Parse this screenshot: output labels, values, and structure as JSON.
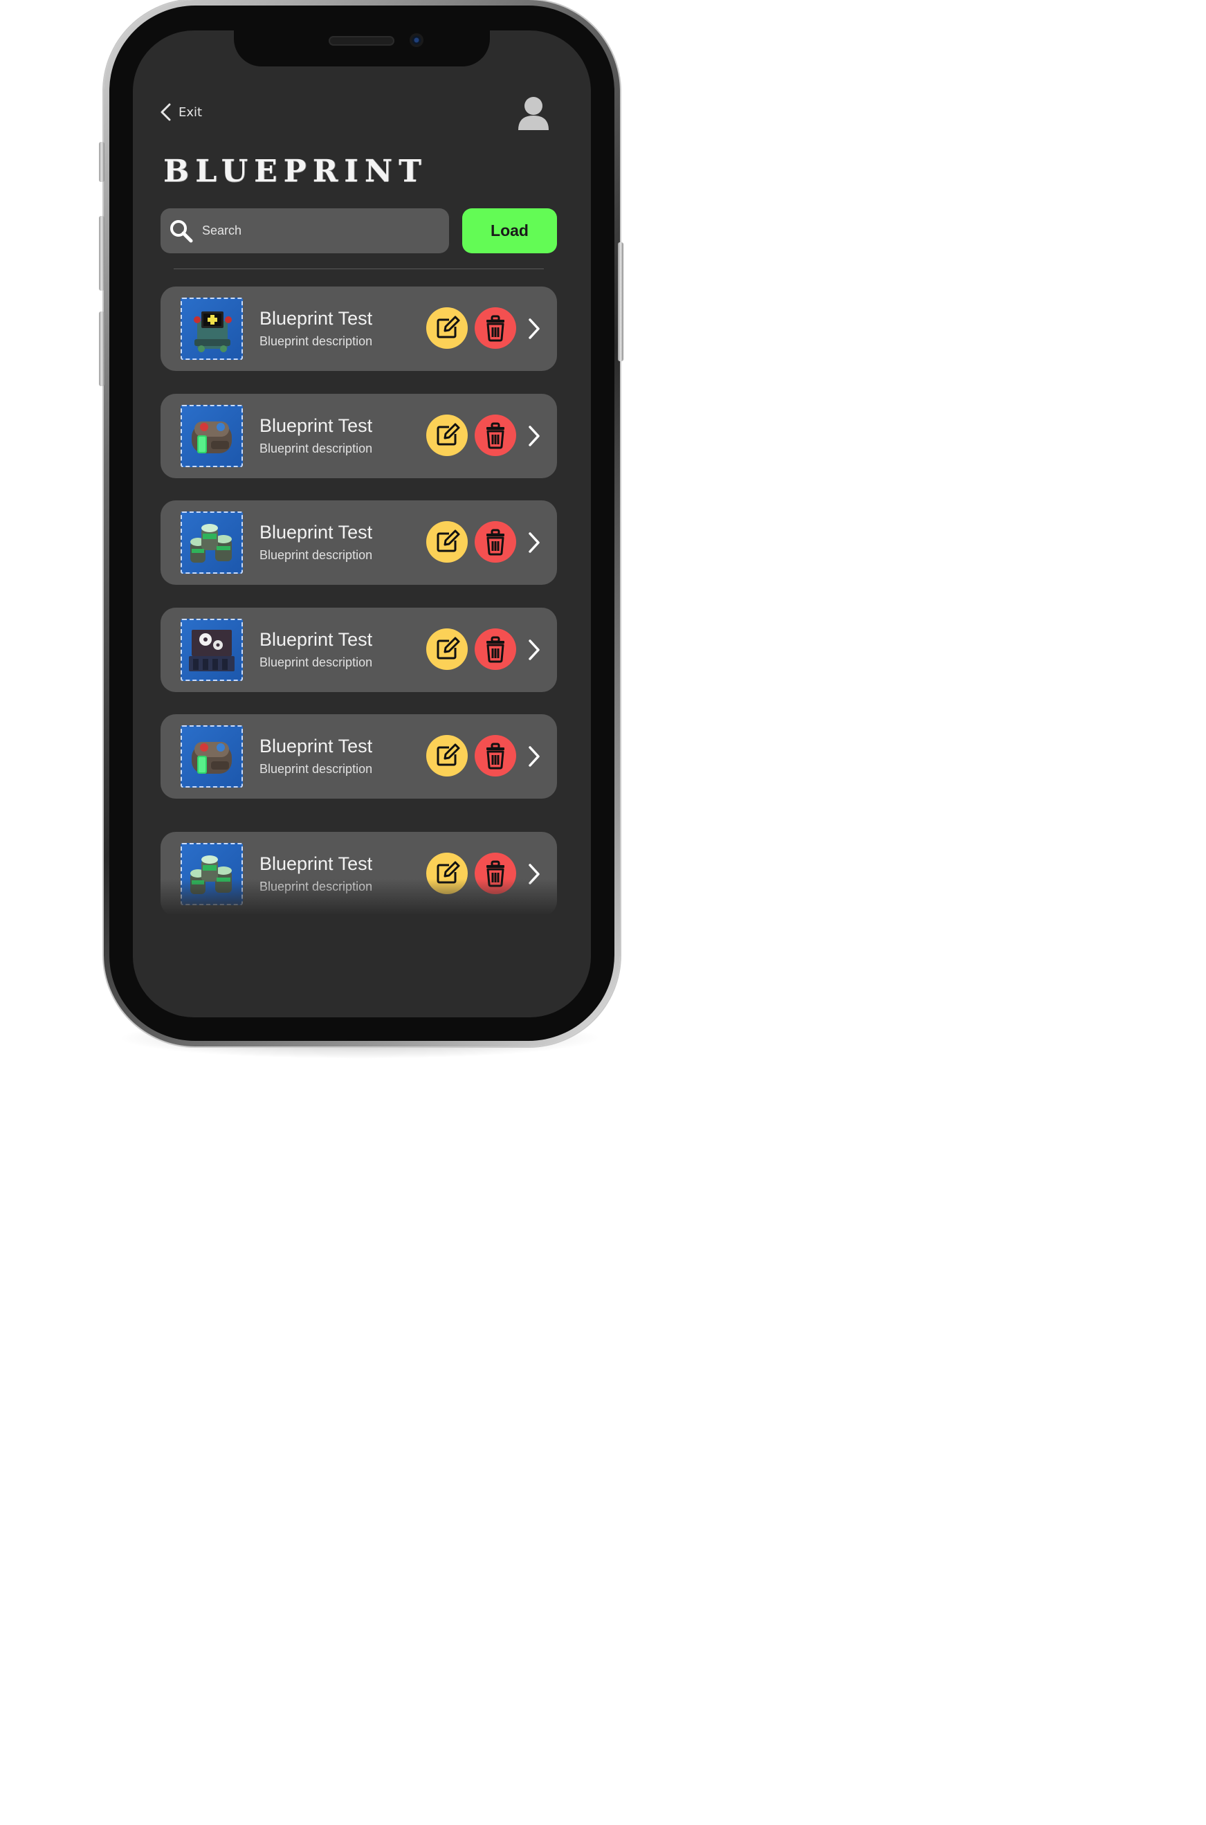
{
  "header": {
    "exit_label": "Exit",
    "title": "BLUEPRINT"
  },
  "search": {
    "placeholder": "Search"
  },
  "load_button": {
    "label": "Load",
    "color": "#63fb55"
  },
  "colors": {
    "screen_bg": "#2c2c2c",
    "card_bg": "#575757",
    "edit": "#fcd157",
    "delete": "#f45050"
  },
  "blueprints": [
    {
      "title": "Blueprint Test",
      "description": "Blueprint description",
      "icon": "machine-with-display-icon"
    },
    {
      "title": "Blueprint Test",
      "description": "Blueprint description",
      "icon": "battery-capsule-icon"
    },
    {
      "title": "Blueprint Test",
      "description": "Blueprint description",
      "icon": "triple-tanks-icon"
    },
    {
      "title": "Blueprint Test",
      "description": "Blueprint description",
      "icon": "gear-box-icon"
    },
    {
      "title": "Blueprint Test",
      "description": "Blueprint description",
      "icon": "battery-capsule-icon"
    },
    {
      "title": "Blueprint Test",
      "description": "Blueprint description",
      "icon": "triple-tanks-icon"
    }
  ]
}
